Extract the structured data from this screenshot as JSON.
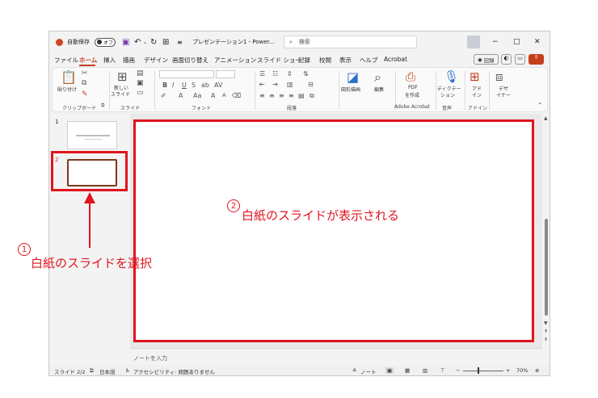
{
  "titlebar": {
    "autosave": "自動保存",
    "toggle": "オフ",
    "filename": "プレゼンテーション1 - Power...",
    "search_placeholder": "検索",
    "minimize": "−",
    "maximize": "□",
    "close": "✕"
  },
  "menu": [
    {
      "label": "ファイル"
    },
    {
      "label": "ホーム"
    },
    {
      "label": "挿入"
    },
    {
      "label": "描画"
    },
    {
      "label": "デザイン"
    },
    {
      "label": "画面切り替え"
    },
    {
      "label": "アニメーション"
    },
    {
      "label": "スライド ショー"
    },
    {
      "label": "記録"
    },
    {
      "label": "校閲"
    },
    {
      "label": "表示"
    },
    {
      "label": "ヘルプ"
    },
    {
      "label": "Acrobat"
    }
  ],
  "record_button": "記録",
  "ribbon": {
    "paste": "貼り付け",
    "new_slide_1": "新しい",
    "new_slide_2": "スライド",
    "shapes": "図形描画",
    "edit": "編集",
    "pdf_1": "PDF",
    "pdf_2": "を作成",
    "dictate_1": "ディクテー",
    "dictate_2": "ション",
    "addin_1": "アド",
    "addin_2": "イン",
    "designer_1": "デザ",
    "designer_2": "イナー",
    "groups": {
      "clipboard": "クリップボード",
      "slides": "スライド",
      "font": "フォント",
      "paragraph": "段落",
      "acrobat": "Adobe Acrobat",
      "voice": "音声",
      "addins": "アドイン"
    }
  },
  "slides_panel": {
    "slide1_num": "1",
    "slide2_num": "2"
  },
  "notes_placeholder": "ノートを入力",
  "status": {
    "slide_count": "スライド 2/2",
    "language": "日本語",
    "accessibility": "アクセシビリティ: 問題ありません",
    "notes_btn": "ノート",
    "zoom": "70%"
  },
  "annotations": {
    "step1_num": "1",
    "step1_text": "白紙のスライドを選択",
    "step2_num": "2",
    "step2_text": "白紙のスライドが表示される"
  },
  "colors": {
    "accent": "#c43e1c",
    "annotation_red": "#e0141e"
  }
}
